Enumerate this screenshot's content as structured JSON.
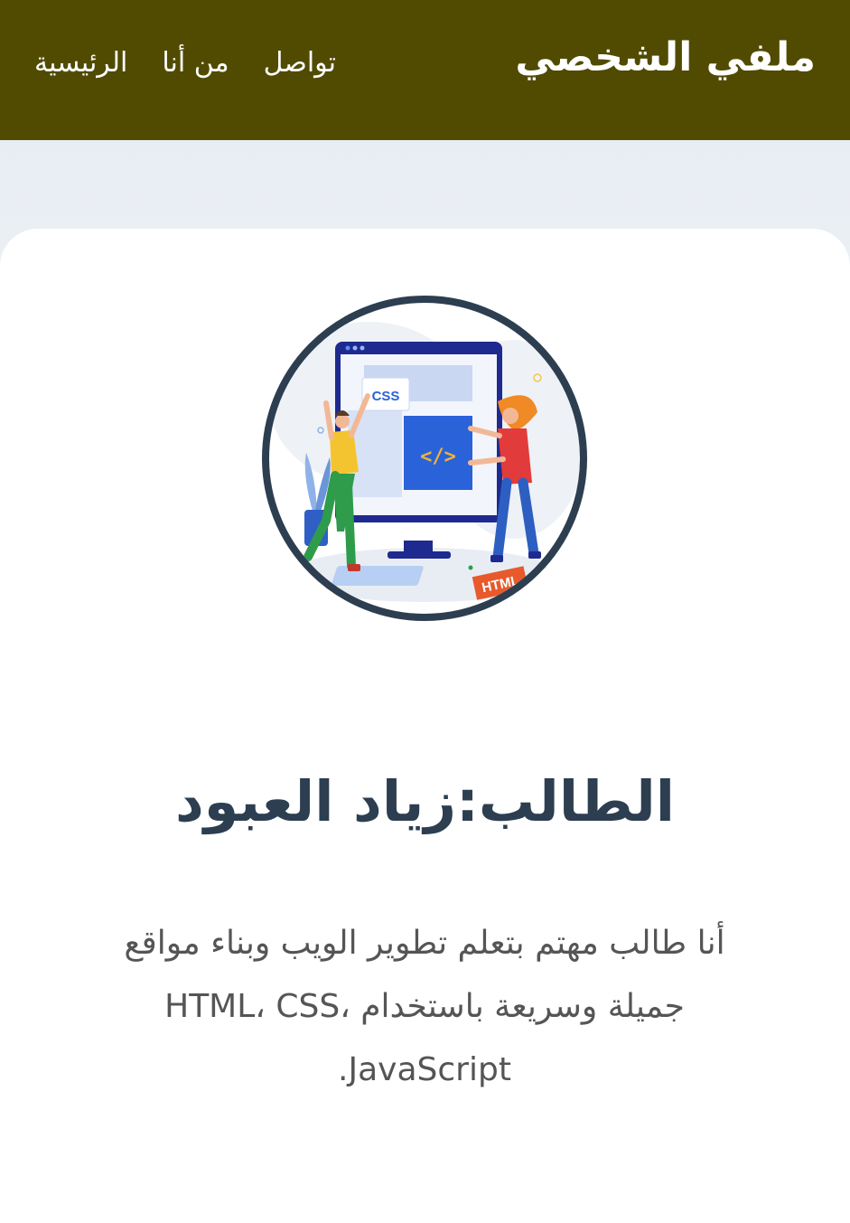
{
  "header": {
    "brand": "ملفي الشخصي",
    "nav": [
      {
        "label": "الرئيسية"
      },
      {
        "label": "من أنا"
      },
      {
        "label": "تواصل"
      }
    ]
  },
  "profile": {
    "avatar_icon": "web-developer-illustration-icon",
    "illustration_badges": {
      "css": "CSS",
      "code": "</>",
      "html": "HTML"
    },
    "name": "الطالب:زياد العبود",
    "bio": "أنا طالب مهتم بتعلم تطوير الويب وبناء مواقع جميلة وسريعة باستخدام HTML، CSS، JavaScript."
  },
  "colors": {
    "navbar": "#514b02",
    "heading": "#2c3e50",
    "text": "#555555"
  }
}
